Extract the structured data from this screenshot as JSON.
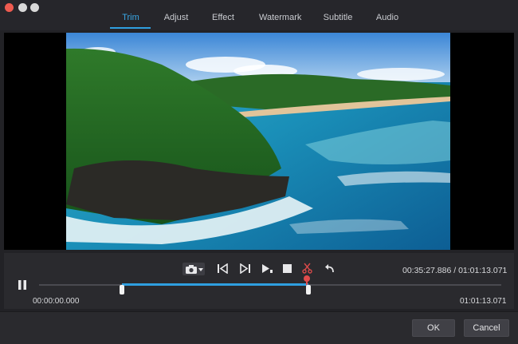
{
  "tabs": [
    {
      "label": "Trim",
      "active": true
    },
    {
      "label": "Adjust"
    },
    {
      "label": "Effect"
    },
    {
      "label": "Watermark"
    },
    {
      "label": "Subtitle"
    },
    {
      "label": "Audio"
    }
  ],
  "player": {
    "current_time": "00:35:27.886",
    "separator": " / ",
    "total_time": "01:01:13.071",
    "clip_start": "00:00:00.000",
    "clip_end": "01:01:13.071",
    "playhead_fraction": 0.58
  },
  "toolbar": {
    "icons": [
      "camera-icon",
      "chevron-down-icon",
      "step-back-icon",
      "step-forward-icon",
      "play-frame-icon",
      "stop-icon",
      "cut-icon",
      "undo-icon"
    ]
  },
  "colors": {
    "accent": "#2f9fe0",
    "playhead": "#e14b4b",
    "cut_icon": "#d94a4a"
  },
  "footer": {
    "ok_label": "OK",
    "cancel_label": "Cancel"
  }
}
